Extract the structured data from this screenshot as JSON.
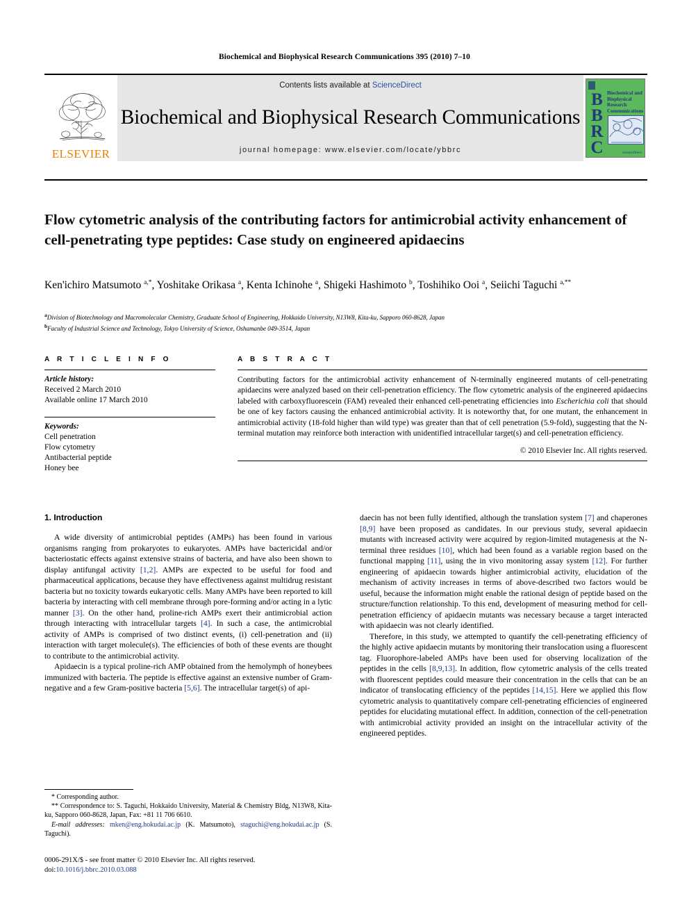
{
  "running_head": "Biochemical and Biophysical Research Communications 395 (2010) 7–10",
  "masthead": {
    "contents_prefix": "Contents lists available at ",
    "sciencedirect": "ScienceDirect",
    "journal_title": "Biochemical and Biophysical Research Communications",
    "homepage": "journal homepage: www.elsevier.com/locate/ybbrc",
    "publisher_logo_text": "ELSEVIER",
    "cover": {
      "acronym": "BBRC",
      "title_lines": "Biochemical and Biophysical Research Communications",
      "imprint": "ScienceDirect"
    },
    "colors": {
      "sciencedirect_link": "#2b4ea2",
      "elsevier_orange": "#F07D00",
      "cover_green": "#5cb85c",
      "cover_blue": "#223a7a",
      "masthead_gray": "#e6e6e6"
    }
  },
  "article": {
    "title": "Flow cytometric analysis of the contributing factors for antimicrobial activity enhancement of cell-penetrating type peptides: Case study on engineered apidaecins",
    "authors_html": "Ken'ichiro Matsumoto <sup>a,*</sup>, Yoshitake Orikasa <sup>a</sup>, Kenta Ichinohe <sup>a</sup>, Shigeki Hashimoto <sup>b</sup>, Toshihiko Ooi <sup>a</sup>, Seiichi Taguchi <sup>a,**</sup>",
    "affiliations": [
      "Division of Biotechnology and Macromolecular Chemistry, Graduate School of Engineering, Hokkaido University, N13W8, Kita-ku, Sapporo 060-8628, Japan",
      "Faculty of Industrial Science and Technology, Tokyo University of Science, Oshamanbe 049-3514, Japan"
    ],
    "affiliation_marks": [
      "a",
      "b"
    ]
  },
  "article_info": {
    "heading": "A R T I C L E   I N F O",
    "history_label": "Article history:",
    "history": [
      "Received 2 March 2010",
      "Available online 17 March 2010"
    ],
    "keywords_label": "Keywords:",
    "keywords": [
      "Cell penetration",
      "Flow cytometry",
      "Antibacterial peptide",
      "Honey bee"
    ]
  },
  "abstract": {
    "heading": "A B S T R A C T",
    "text_html": "Contributing factors for the antimicrobial activity enhancement of N-terminally engineered mutants of cell-penetrating apidaecins were analyzed based on their cell-penetration efficiency. The flow cytometric analysis of the engineered apidaecins labeled with carboxyfluorescein (FAM) revealed their enhanced cell-penetrating efficiencies into <span class=\"ital\">Escherichia coli</span> that should be one of key factors causing the enhanced antimicrobial activity. It is noteworthy that, for one mutant, the enhancement in antimicrobial activity (18-fold higher than wild type) was greater than that of cell penetration (5.9-fold), suggesting that the N-terminal mutation may reinforce both interaction with unidentified intracellular target(s) and cell-penetration efficiency.",
    "copyright": "© 2010 Elsevier Inc. All rights reserved."
  },
  "body": {
    "section_heading": "1. Introduction",
    "left_paragraphs_html": [
      "A wide diversity of antimicrobial peptides (AMPs) has been found in various organisms ranging from prokaryotes to eukaryotes. AMPs have bactericidal and/or bacteriostatic effects against extensive strains of bacteria, and have also been shown to display antifungal activity <span class=\"ref\">[1,2]</span>. AMPs are expected to be useful for food and pharmaceutical applications, because they have effectiveness against multidrug resistant bacteria but no toxicity towards eukaryotic cells. Many AMPs have been reported to kill bacteria by interacting with cell membrane through pore-forming and/or acting in a lytic manner <span class=\"ref\">[3]</span>. On the other hand, proline-rich AMPs exert their antimicrobial action through interacting with intracellular targets <span class=\"ref\">[4]</span>. In such a case, the antimicrobial activity of AMPs is comprised of two distinct events, (i) cell-penetration and (ii) interaction with target molecule(s). The efficiencies of both of these events are thought to contribute to the antimicrobial activity.",
      "Apidaecin is a typical proline-rich AMP obtained from the hemolymph of honeybees immunized with bacteria. The peptide is effective against an extensive number of Gram-negative and a few Gram-positive bacteria <span class=\"ref\">[5,6]</span>. The intracellular target(s) of api-"
    ],
    "right_paragraphs_html": [
      "daecin has not been fully identified, although the translation system <span class=\"ref\">[7]</span> and chaperones <span class=\"ref\">[8,9]</span> have been proposed as candidates. In our previous study, several apidaecin mutants with increased activity were acquired by region-limited mutagenesis at the N-terminal three residues <span class=\"ref\">[10]</span>, which had been found as a variable region based on the functional mapping <span class=\"ref\">[11]</span>, using the in vivo monitoring assay system <span class=\"ref\">[12]</span>. For further engineering of apidaecin towards higher antimicrobial activity, elucidation of the mechanism of activity increases in terms of above-described two factors would be useful, because the information might enable the rational design of peptide based on the structure/function relationship. To this end, development of measuring method for cell-penetration efficiency of apidaecin mutants was necessary because a target interacted with apidaecin was not clearly identified.",
      "Therefore, in this study, we attempted to quantify the cell-penetrating efficiency of the highly active apidaecin mutants by monitoring their translocation using a fluorescent tag. Fluorophore-labeled AMPs have been used for observing localization of the peptides in the cells <span class=\"ref\">[8,9,13]</span>. In addition, flow cytometric analysis of the cells treated with fluorescent peptides could measure their concentration in the cells that can be an indicator of translocating efficiency of the peptides <span class=\"ref\">[14,15]</span>. Here we applied this flow cytometric analysis to quantitatively compare cell-penetrating efficiencies of engineered peptides for elucidating mutational effect. In addition, connection of the cell-penetration with antimicrobial activity provided an insight on the intracellular activity of the engineered peptides."
    ]
  },
  "footnotes": {
    "corresponding_author": "* Corresponding author.",
    "correspondence_to_html": "** Correspondence to: S. Taguchi, Hokkaido University, Material &amp; Chemistry Bldg, N13W8, Kita-ku, Sapporo 060-8628, Japan, Fax: +81 11 706 6610.",
    "email_label": "E-mail addresses:",
    "emails_html": "<span class=\"mail\">mken@eng.hokudai.ac.jp</span> (K. Matsumoto), <span class=\"mail\">staguchi@eng.hokudai.ac.jp</span> (S. Taguchi)."
  },
  "imprint": {
    "issn_line": "0006-291X/$ - see front matter © 2010 Elsevier Inc. All rights reserved.",
    "doi_prefix": "doi:",
    "doi": "10.1016/j.bbrc.2010.03.088"
  }
}
